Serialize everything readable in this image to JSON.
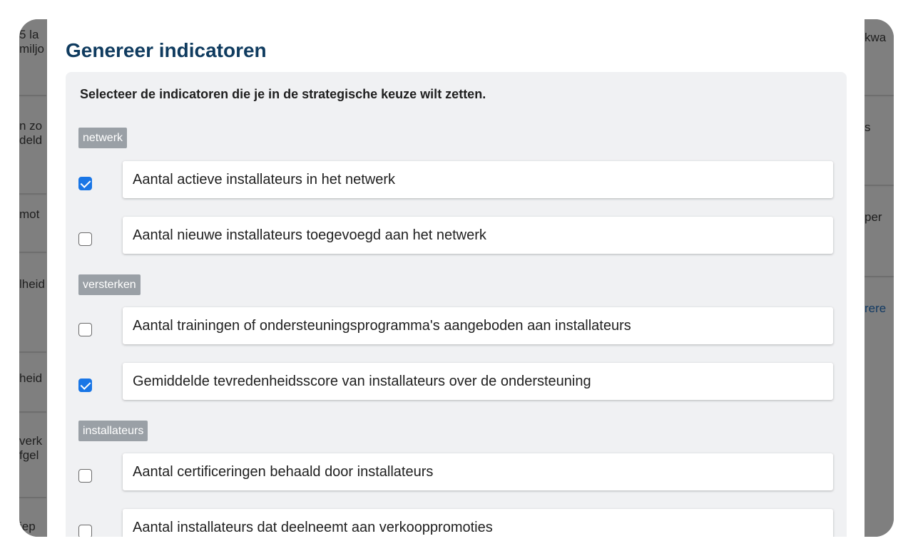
{
  "background": {
    "left_fragments": [
      [
        "5 la",
        "miljo"
      ],
      [
        "n zo",
        "deld"
      ],
      [
        "mot"
      ],
      [
        "lheid"
      ],
      [
        "heid"
      ],
      [
        "verk",
        "fgel"
      ],
      [
        "iep"
      ]
    ],
    "right_fragments": [
      [
        "kwa"
      ],
      [
        "s"
      ],
      [
        "per"
      ],
      [
        "rere"
      ]
    ]
  },
  "modal": {
    "close_icon": "close-icon",
    "title": "Genereer indicatoren",
    "instruction": "Selecteer de indicatoren die je in de strategische keuze wilt zetten.",
    "groups": [
      {
        "tag": "netwerk",
        "items": [
          {
            "label": "Aantal actieve installateurs in het netwerk",
            "checked": true
          },
          {
            "label": "Aantal nieuwe installateurs toegevoegd aan het netwerk",
            "checked": false
          }
        ]
      },
      {
        "tag": "versterken",
        "items": [
          {
            "label": "Aantal trainingen of ondersteuningsprogramma's aangeboden aan installateurs",
            "checked": false
          },
          {
            "label": "Gemiddelde tevredenheidsscore van installateurs over de ondersteuning",
            "checked": true
          }
        ]
      },
      {
        "tag": "installateurs",
        "items": [
          {
            "label": "Aantal certificeringen behaald door installateurs",
            "checked": false
          },
          {
            "label": "Aantal installateurs dat deelneemt aan verkooppromoties",
            "checked": false
          }
        ]
      }
    ]
  },
  "colors": {
    "title": "#0f3b5f",
    "checkbox_checked": "#1976e6",
    "tag_bg": "#9aa0a6",
    "panel_bg": "#f0f1f3",
    "overlay": "#7d7d7d"
  }
}
